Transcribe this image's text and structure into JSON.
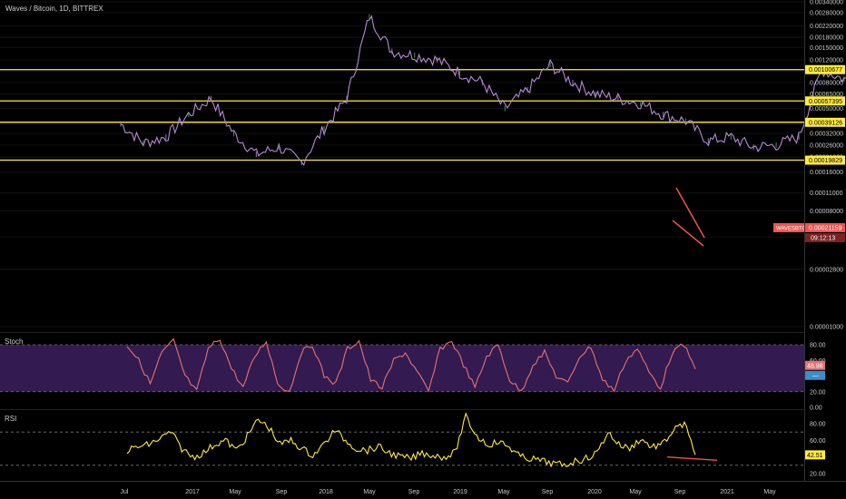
{
  "header": {
    "symbol_title": "Waves / Bitcoin, 1D, BITTREX"
  },
  "price_pane": {
    "axis_labels": [
      "0.00340000",
      "0.00280000",
      "0.00220000",
      "0.00180000",
      "0.00150000",
      "0.00120000",
      "0.00100000",
      "0.00080000",
      "0.00065000",
      "0.00050000",
      "0.00040000",
      "0.00032000",
      "0.00026000",
      "0.00021000",
      "0.00016000",
      "0.00011000",
      "0.00008000",
      "0.00005000",
      "0.00002800",
      "0.00001000"
    ],
    "axis_values": [
      0.0034,
      0.0028,
      0.0022,
      0.0018,
      0.0015,
      0.0012,
      0.001,
      0.0008,
      0.00065,
      0.0005,
      0.0004,
      0.00032,
      0.00026,
      0.00021,
      0.00016,
      0.00011,
      8e-05,
      5e-05,
      2.8e-05,
      1e-05
    ],
    "levels": [
      {
        "value": 0.00100677,
        "label": "0.00100677"
      },
      {
        "value": 0.00057395,
        "label": "0.00057395"
      },
      {
        "value": 0.00039126,
        "label": "0.00039126"
      },
      {
        "value": 0.00019829,
        "label": "0.00019829"
      }
    ],
    "current": {
      "symbol": "WAVESBTC",
      "price": "0.00021159",
      "countdown": "09:12:13"
    },
    "colors": {
      "level": "#ffeb3b",
      "pattern": "#ef5350",
      "line": "#b38ad6",
      "up": "#4caf50",
      "current": "#ef5350"
    }
  },
  "stoch_pane": {
    "title": "Stoch",
    "axis_labels": [
      "80.00",
      "60.00",
      "40.00",
      "20.00",
      "0.00"
    ],
    "axis_values": [
      80,
      60,
      40,
      20,
      0
    ],
    "badges": [
      "48.98",
      "—"
    ],
    "colors": {
      "line": "#e57373",
      "band": "#3c1f5e"
    }
  },
  "rsi_pane": {
    "title": "RSI",
    "axis_labels": [
      "80.00",
      "60.00",
      "40.00",
      "20.00"
    ],
    "axis_values": [
      80,
      60,
      40,
      20
    ],
    "badge": "42.51",
    "colors": {
      "line": "#ffeb3b",
      "trend": "#ef5350"
    }
  },
  "x_axis": {
    "labels": [
      "Jul",
      "2017",
      "May",
      "Sep",
      "2018",
      "May",
      "Sep",
      "2019",
      "May",
      "Sep",
      "2020",
      "May",
      "Sep",
      "2021",
      "May"
    ]
  },
  "chart_data": {
    "type": "line",
    "title": "Waves / Bitcoin, 1D, BITTREX",
    "scale": "log",
    "series": [
      {
        "name": "WAVESBTC",
        "x": [
          "2016-06",
          "2016-07",
          "2016-08",
          "2016-09",
          "2016-10",
          "2016-11",
          "2016-12",
          "2017-01",
          "2017-02",
          "2017-03",
          "2017-04",
          "2017-05",
          "2017-06",
          "2017-07",
          "2017-08",
          "2017-09",
          "2017-10",
          "2017-11",
          "2017-12",
          "2018-01",
          "2018-02",
          "2018-03",
          "2018-04",
          "2018-05",
          "2018-06",
          "2018-07",
          "2018-08",
          "2018-09",
          "2018-10",
          "2018-11",
          "2018-12",
          "2019-01",
          "2019-02",
          "2019-03",
          "2019-04",
          "2019-05",
          "2019-06",
          "2019-07",
          "2019-08",
          "2019-09",
          "2019-10",
          "2019-11",
          "2019-12",
          "2020-01",
          "2020-02",
          "2020-03",
          "2020-04",
          "2020-05",
          "2020-06",
          "2020-07",
          "2020-08",
          "2020-09",
          "2020-10"
        ],
        "values": [
          0.00038,
          0.00027,
          0.0003,
          0.00045,
          0.0006,
          0.00032,
          0.00022,
          0.00025,
          0.00019,
          0.00035,
          0.0006,
          0.0026,
          0.0014,
          0.0013,
          0.0012,
          0.00095,
          0.0008,
          0.0005,
          0.0007,
          0.0011,
          0.0008,
          0.00065,
          0.0006,
          0.00055,
          0.00045,
          0.0004,
          0.00028,
          0.0003,
          0.00025,
          0.00026,
          0.0003,
          0.001,
          0.00085,
          0.00075,
          0.0006,
          0.00045,
          0.00035,
          0.00026,
          0.00016,
          0.0001,
          9e-05,
          8.5e-05,
          8e-05,
          9.5e-05,
          0.00013,
          0.0001,
          0.00013,
          0.00014,
          0.00011,
          0.00013,
          0.0002,
          0.00037,
          0.00021
        ]
      }
    ],
    "stoch": {
      "values": [
        80,
        60,
        30,
        70,
        85,
        40,
        20,
        75,
        88,
        50,
        25,
        65,
        85,
        30,
        20,
        70,
        80,
        40,
        30,
        75,
        85,
        35,
        25,
        60,
        70,
        45,
        20,
        75,
        85,
        55,
        25,
        65,
        80,
        35,
        20,
        55,
        70,
        40,
        30,
        65,
        78,
        35,
        22,
        60,
        75,
        45,
        25,
        70,
        80,
        48.98
      ]
    },
    "rsi": {
      "values": [
        48,
        52,
        55,
        62,
        70,
        50,
        40,
        45,
        55,
        60,
        48,
        65,
        85,
        75,
        55,
        60,
        50,
        42,
        55,
        72,
        60,
        50,
        48,
        52,
        45,
        40,
        38,
        45,
        42,
        40,
        45,
        88,
        65,
        55,
        58,
        52,
        40,
        38,
        35,
        32,
        30,
        35,
        38,
        45,
        70,
        55,
        50,
        62,
        52,
        55,
        72,
        80,
        42.51
      ]
    }
  }
}
